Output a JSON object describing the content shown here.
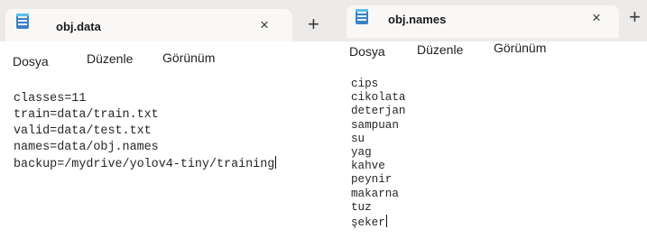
{
  "windows": [
    {
      "tab_title": "obj.data",
      "menu": [
        "Dosya",
        "Düzenle",
        "Görünüm"
      ],
      "lines": [
        "classes=11",
        "train=data/train.txt",
        "valid=data/test.txt",
        "names=data/obj.names",
        "backup=/mydrive/yolov4-tiny/training"
      ],
      "close_glyph": "×",
      "new_tab_glyph": "+"
    },
    {
      "tab_title": "obj.names",
      "menu": [
        "Dosya",
        "Düzenle",
        "Görünüm"
      ],
      "lines": [
        "cips",
        "cikolata",
        "deterjan",
        "sampuan",
        "su",
        "yag",
        "kahve",
        "peynir",
        "makarna",
        "tuz",
        "şeker"
      ],
      "close_glyph": "×",
      "new_tab_glyph": "+"
    }
  ]
}
